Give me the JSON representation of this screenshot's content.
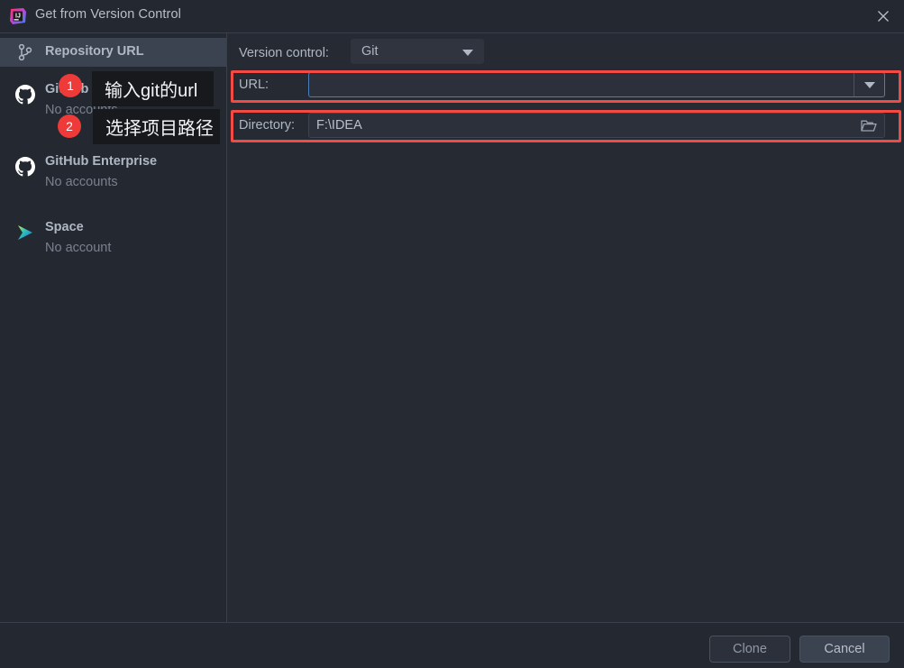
{
  "window": {
    "title": "Get from Version Control",
    "app_icon": "intellij-idea-logo",
    "close_icon": "close-icon"
  },
  "sidebar": {
    "items": [
      {
        "title": "Repository URL",
        "subtitle": "",
        "icon": "git-branch-icon",
        "selected": true
      },
      {
        "title": "GitHub",
        "subtitle": "No accounts",
        "icon": "github-icon",
        "selected": false
      },
      {
        "title": "GitHub Enterprise",
        "subtitle": "No accounts",
        "icon": "github-icon",
        "selected": false
      },
      {
        "title": "Space",
        "subtitle": "No account",
        "icon": "jetbrains-space-icon",
        "selected": false
      }
    ]
  },
  "form": {
    "version_control": {
      "label": "Version control:",
      "value": "Git",
      "options": [
        "Git"
      ]
    },
    "url": {
      "label": "URL:",
      "value": "",
      "placeholder": "",
      "dropdown_icon": "chevron-down-icon",
      "highlighted": true
    },
    "directory": {
      "label": "Directory:",
      "value": "F:\\IDEA",
      "placeholder": "",
      "browse_icon": "folder-icon",
      "highlighted": true
    }
  },
  "annotations": {
    "callouts": [
      {
        "badge": "1",
        "text": "输入git的url"
      },
      {
        "badge": "2",
        "text": "选择项目路径"
      }
    ],
    "highlight_color": "#f24a44",
    "badge_color": "#ef3a3a"
  },
  "footer": {
    "clone_label": "Clone",
    "cancel_label": "Cancel"
  }
}
